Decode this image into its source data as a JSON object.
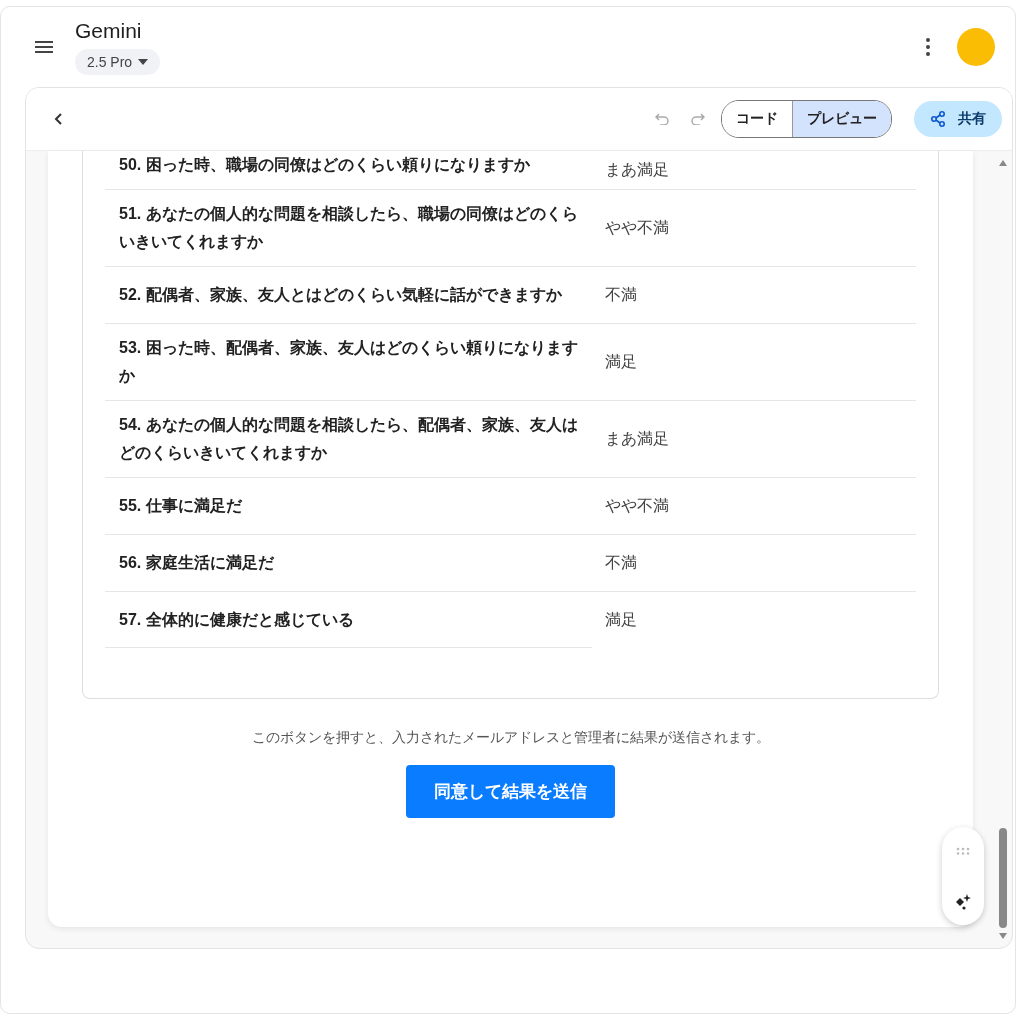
{
  "header": {
    "title": "Gemini",
    "model": "2.5 Pro"
  },
  "toolbar": {
    "modes": [
      {
        "label": "コード",
        "selected": false
      },
      {
        "label": "プレビュー",
        "selected": true
      }
    ],
    "share": "共有"
  },
  "rows": [
    {
      "question": "50. 困った時、職場の同僚はどのくらい頼りになりますか",
      "answer": "まあ満足"
    },
    {
      "question": "51. あなたの個人的な問題を相談したら、職場の同僚はどのくらいきいてくれますか",
      "answer": "やや不満"
    },
    {
      "question": "52. 配偶者、家族、友人とはどのくらい気軽に話ができますか",
      "answer": "不満"
    },
    {
      "question": "53. 困った時、配偶者、家族、友人はどのくらい頼りになりますか",
      "answer": "満足"
    },
    {
      "question": "54. あなたの個人的な問題を相談したら、配偶者、家族、友人はどのくらいきいてくれますか",
      "answer": "まあ満足"
    },
    {
      "question": "55. 仕事に満足だ",
      "answer": "やや不満"
    },
    {
      "question": "56. 家庭生活に満足だ",
      "answer": "不満"
    },
    {
      "question": "57. 全体的に健康だと感じている",
      "answer": "満足"
    }
  ],
  "notice": "このボタンを押すと、入力されたメールアドレスと管理者に結果が送信されます。",
  "submit": "同意して結果を送信"
}
